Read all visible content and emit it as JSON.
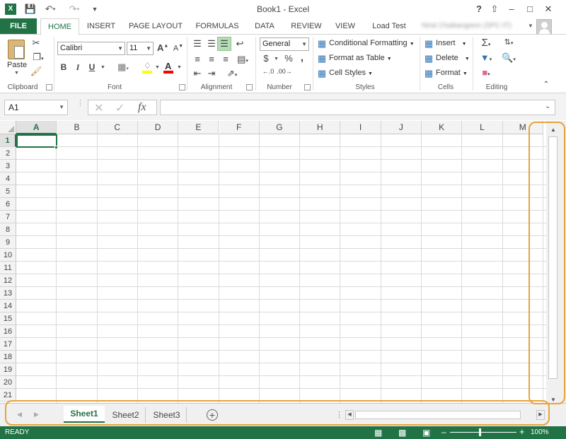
{
  "title": "Book1 - Excel",
  "user": "Nirat Chaikangwon (SPC-IT)",
  "colors": {
    "accent": "#217346",
    "highlight": "#e8a33d"
  },
  "tabs": [
    {
      "label": "FILE"
    },
    {
      "label": "HOME"
    },
    {
      "label": "INSERT"
    },
    {
      "label": "PAGE LAYOUT"
    },
    {
      "label": "FORMULAS"
    },
    {
      "label": "DATA"
    },
    {
      "label": "REVIEW"
    },
    {
      "label": "VIEW"
    },
    {
      "label": "Load Test"
    }
  ],
  "ribbon": {
    "clipboard": {
      "label": "Clipboard",
      "paste": "Paste"
    },
    "font": {
      "label": "Font",
      "name": "Calibri",
      "size": "11",
      "bold": "B",
      "italic": "I",
      "underline": "U"
    },
    "alignment": {
      "label": "Alignment"
    },
    "number": {
      "label": "Number",
      "format": "General",
      "currency": "$",
      "percent": "%"
    },
    "styles": {
      "label": "Styles",
      "conditional": "Conditional Formatting",
      "format_table": "Format as Table",
      "cell_styles": "Cell Styles"
    },
    "cells": {
      "label": "Cells",
      "insert": "Insert",
      "delete": "Delete",
      "format": "Format"
    },
    "editing": {
      "label": "Editing"
    }
  },
  "name_box": "A1",
  "fx": "fx",
  "columns": [
    "A",
    "B",
    "C",
    "D",
    "E",
    "F",
    "G",
    "H",
    "I",
    "J",
    "K",
    "L",
    "M"
  ],
  "rows": [
    "1",
    "2",
    "3",
    "4",
    "5",
    "6",
    "7",
    "8",
    "9",
    "10",
    "11",
    "12",
    "13",
    "14",
    "15",
    "16",
    "17",
    "18",
    "19",
    "20",
    "21"
  ],
  "sheets": [
    {
      "label": "Sheet1",
      "active": true
    },
    {
      "label": "Sheet2"
    },
    {
      "label": "Sheet3"
    }
  ],
  "status": {
    "ready": "READY",
    "zoom": "100%"
  }
}
